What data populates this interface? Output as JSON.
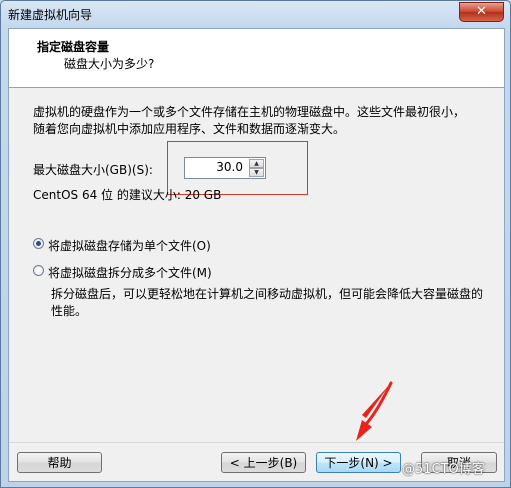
{
  "window": {
    "title": "新建虚拟机向导",
    "close_glyph": "✕"
  },
  "header": {
    "title": "指定磁盘容量",
    "subtitle": "磁盘大小为多少?"
  },
  "description": "虚拟机的硬盘作为一个或多个文件存储在主机的物理磁盘中。这些文件最初很小，随着您向虚拟机中添加应用程序、文件和数据而逐渐变大。",
  "disk": {
    "size_label": "最大磁盘大小(GB)(S):",
    "size_value": "30.0",
    "recommended": "CentOS 64 位 的建议大小: 20 GB"
  },
  "options": [
    {
      "label": "将虚拟磁盘存储为单个文件(O)",
      "checked": true
    },
    {
      "label": "将虚拟磁盘拆分成多个文件(M)",
      "checked": false
    }
  ],
  "split_note": "拆分磁盘后，可以更轻松地在计算机之间移动虚拟机，但可能会降低大容量磁盘的性能。",
  "buttons": {
    "help": "帮助",
    "back": "< 上一步(B)",
    "next": "下一步(N) >",
    "cancel": "取消"
  },
  "watermark": "@51CTO博客",
  "colors": {
    "annotation": "#e8231a"
  }
}
